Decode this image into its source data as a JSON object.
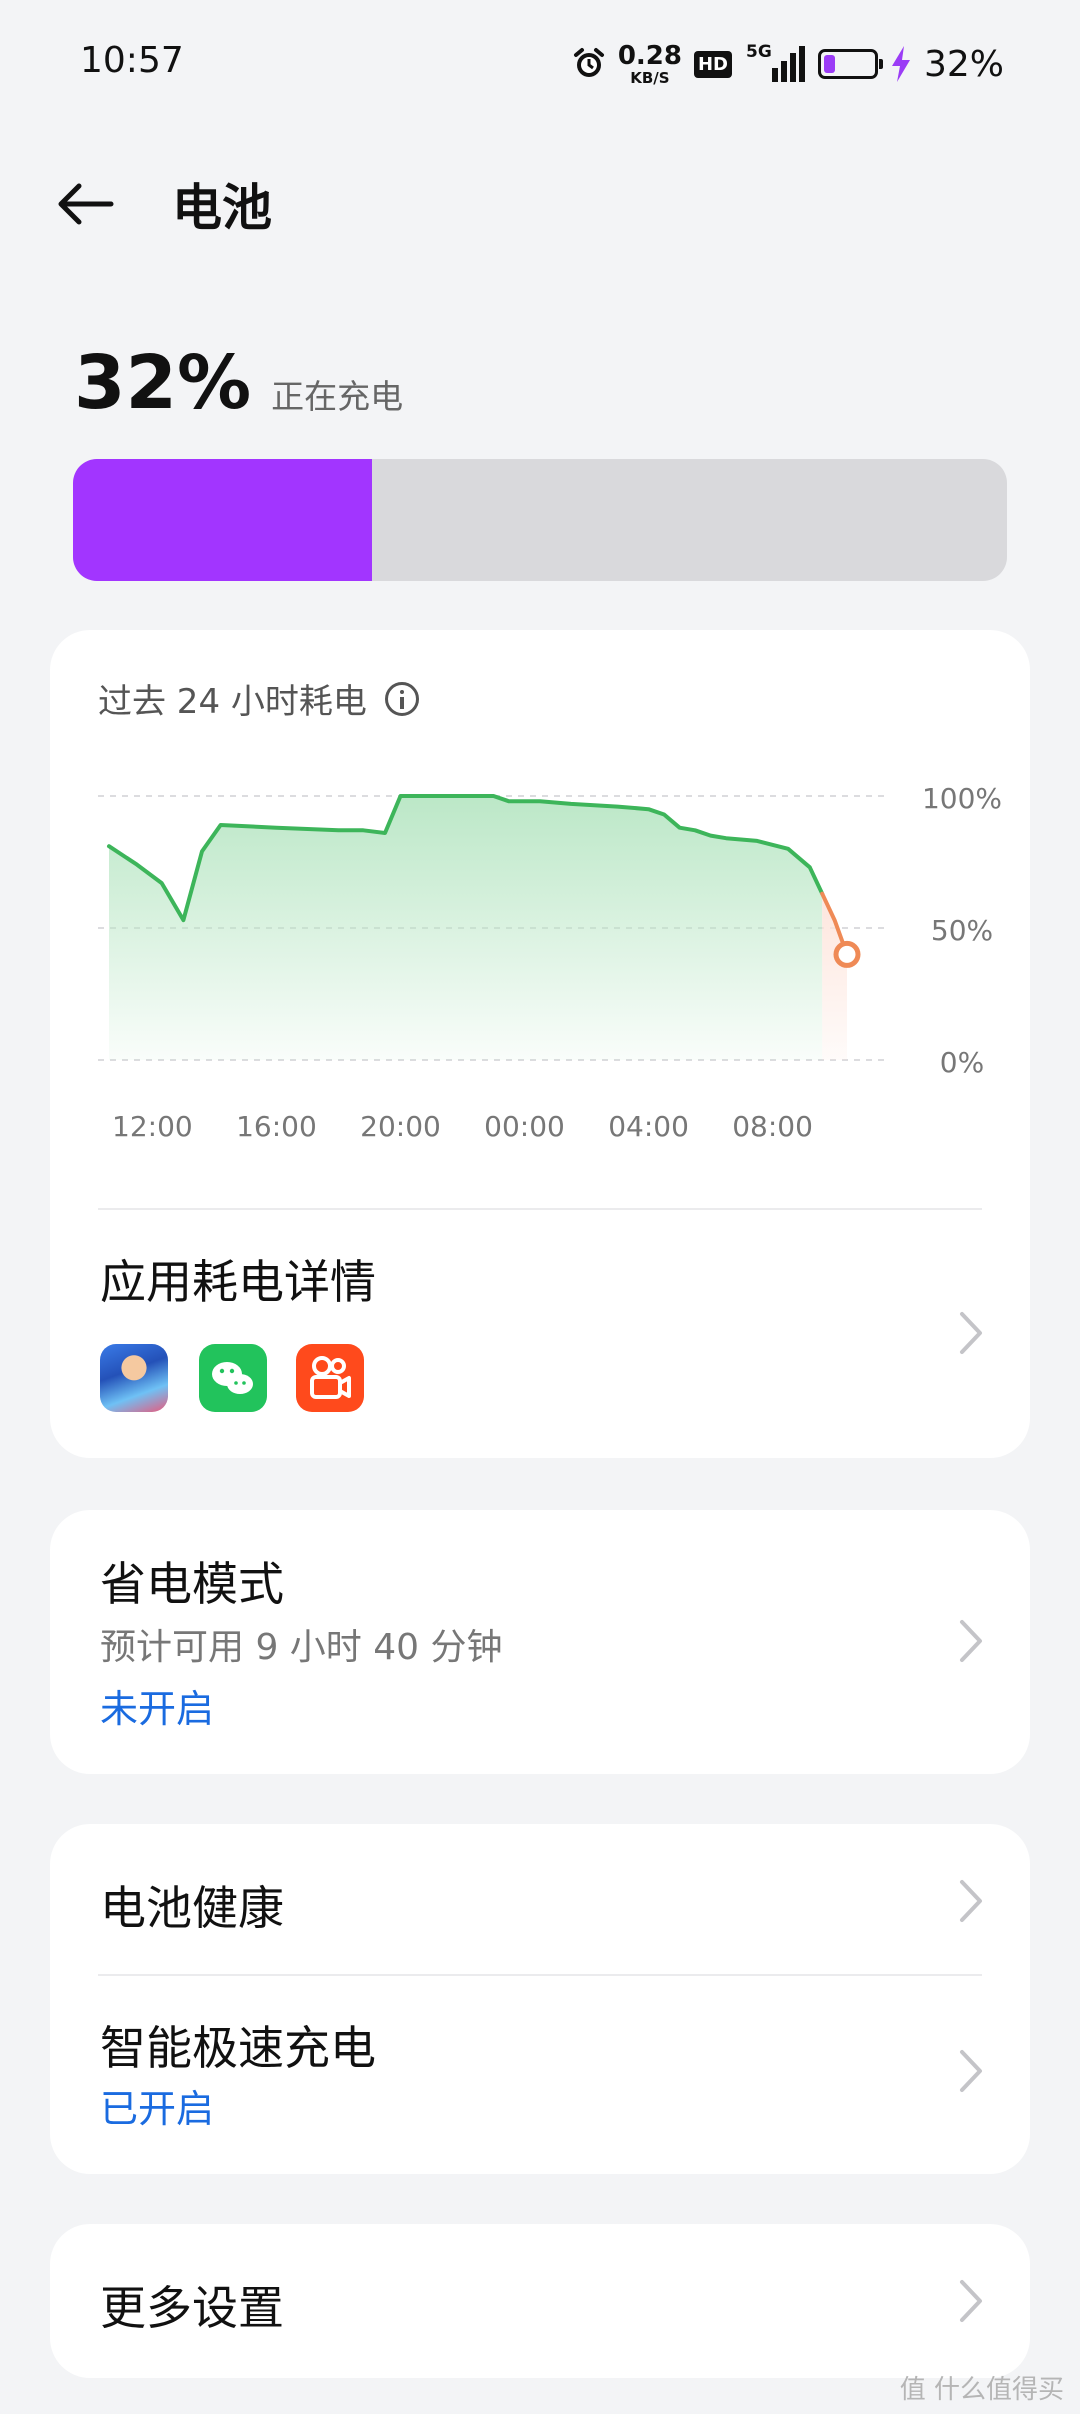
{
  "status_bar": {
    "time": "10:57",
    "net_speed_value": "0.28",
    "net_speed_unit": "KB/S",
    "hd_label": "HD",
    "network_label": "5G",
    "battery_percent": "32%",
    "battery_level": 0.32,
    "icons": [
      "alarm-icon",
      "signal-icon",
      "battery-icon",
      "charging-bolt-icon"
    ]
  },
  "header": {
    "title": "电池",
    "back_icon": "arrow-left-icon"
  },
  "battery": {
    "percent_text": "32%",
    "status_text": "正在充电",
    "level": 0.32,
    "fill_color": "#a235ff"
  },
  "usage_card": {
    "title": "过去 24 小时耗电",
    "info_icon": "info-icon"
  },
  "chart_data": {
    "type": "area",
    "title": "过去 24 小时耗电",
    "xlabel": "",
    "ylabel": "",
    "y_tick_labels": [
      "100%",
      "50%",
      "0%"
    ],
    "x_tick_labels": [
      "12:00",
      "16:00",
      "20:00",
      "00:00",
      "04:00",
      "08:00"
    ],
    "ylim": [
      0,
      100
    ],
    "xlim": [
      10.6,
      34.4
    ],
    "grid": true,
    "colors": {
      "discharge_line": "#3db55a",
      "discharge_fill": "#b8e6c4",
      "recent_line": "#ef8a56",
      "recent_fill": "#fde4db"
    },
    "series": [
      {
        "values_x": [
          10.6,
          11.5,
          12.3,
          13.0,
          13.6,
          14.2,
          16.0,
          18.0,
          18.8,
          19.5,
          20.0,
          20.5,
          21.0,
          23.0,
          23.5,
          24.5,
          25.5,
          27.0,
          28.0,
          28.5,
          29.0,
          29.5,
          30.0,
          30.5,
          31.5,
          32.5,
          33.2,
          33.6
        ],
        "values_y": [
          81,
          74,
          67,
          53,
          79,
          89,
          88,
          87,
          87,
          86,
          100,
          100,
          100,
          100,
          98,
          98,
          97,
          96,
          95,
          93,
          88,
          87,
          85,
          84,
          83,
          80,
          73,
          63
        ],
        "color": "#3db55a"
      },
      {
        "values_x": [
          33.6,
          34.0,
          34.4
        ],
        "values_y": [
          63,
          53,
          40
        ],
        "color": "#ef8a56"
      }
    ]
  },
  "app_usage": {
    "title": "应用耗电详情",
    "apps": [
      "game-app-icon",
      "wechat-icon",
      "kuaishou-icon"
    ]
  },
  "power_saving": {
    "title": "省电模式",
    "estimate": "预计可用 9 小时 40 分钟",
    "status": "未开启",
    "status_color": "#1a6be0"
  },
  "battery_health": {
    "title": "电池健康"
  },
  "fast_charge": {
    "title": "智能极速充电",
    "status": "已开启",
    "status_color": "#1a6be0"
  },
  "more_settings": {
    "title": "更多设置"
  },
  "watermark": "值 什么值得买"
}
